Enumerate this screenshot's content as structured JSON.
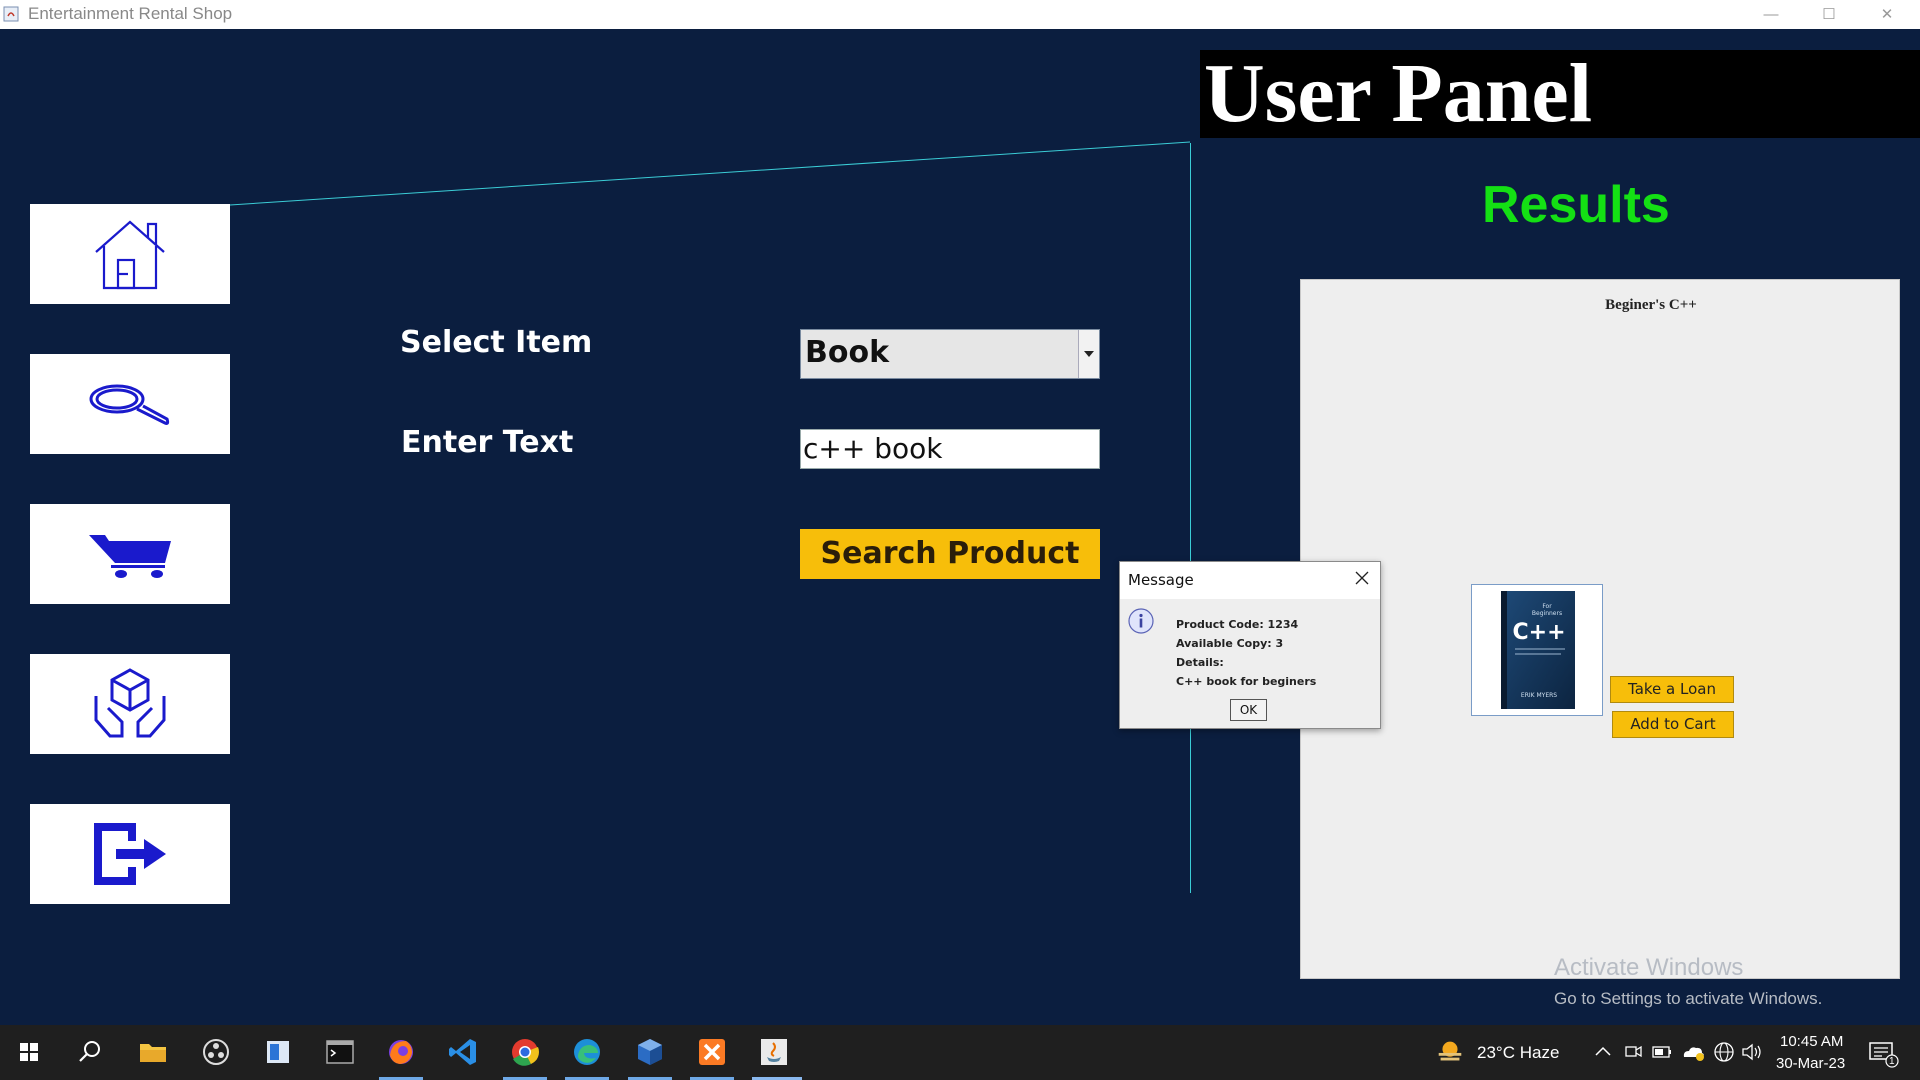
{
  "window": {
    "title": "Entertainment Rental Shop",
    "minimize_glyph": "—",
    "maximize_glyph": "☐",
    "close_glyph": "✕"
  },
  "header": {
    "title": "User Panel"
  },
  "results": {
    "heading": "Results"
  },
  "sidebar": {
    "items": [
      {
        "name": "home",
        "icon": "home-icon"
      },
      {
        "name": "search",
        "icon": "search-icon"
      },
      {
        "name": "cart",
        "icon": "cart-icon"
      },
      {
        "name": "rentals",
        "icon": "hands-box-icon"
      },
      {
        "name": "logout",
        "icon": "logout-icon"
      }
    ]
  },
  "form": {
    "select_label": "Select Item",
    "select_value": "Book",
    "text_label": "Enter Text",
    "text_value": "c++ book",
    "search_button": "Search Product"
  },
  "product": {
    "name": "Beginer's C++",
    "take_loan": "Take a Loan",
    "add_to_cart": "Add to Cart",
    "cover": {
      "top_line1": "For",
      "top_line2": "Beginners",
      "title": "C++",
      "author": "ERIK MYERS"
    }
  },
  "dialog": {
    "title": "Message",
    "lines": [
      "Product Code: 1234",
      "Available Copy: 3",
      "Details:",
      "C++ book for beginers"
    ],
    "ok": "OK"
  },
  "watermark": {
    "line1": "Activate Windows",
    "line2": "Go to Settings to activate Windows."
  },
  "taskbar": {
    "weather": "23°C  Haze",
    "time": "10:45 AM",
    "date": "30-Mar-23",
    "notification_count": "1"
  },
  "colors": {
    "background": "#0b1e3f",
    "accent": "#f7be0a",
    "results": "#14e014",
    "icon_blue": "#1a1acc",
    "divider": "#3bcdd6"
  }
}
